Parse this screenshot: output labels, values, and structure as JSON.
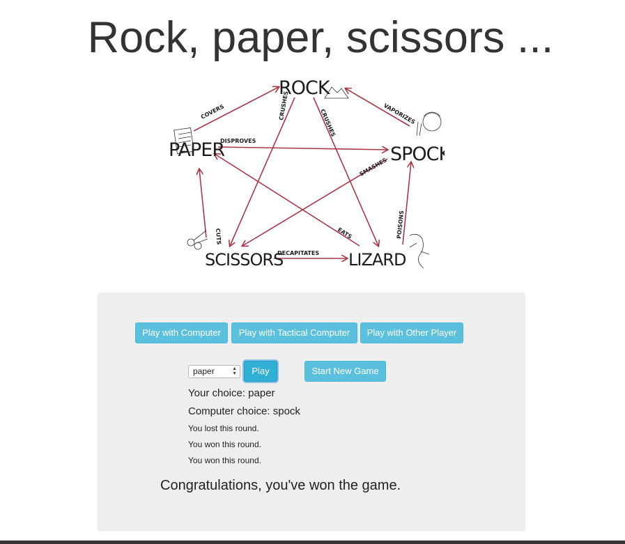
{
  "page": {
    "title": "Rock, paper, scissors ..."
  },
  "diagram": {
    "nodes": {
      "rock": "ROCK",
      "paper": "PAPER",
      "spock": "SPOCK",
      "scissors": "SCISSORS",
      "lizard": "LIZARD"
    },
    "verbs": {
      "covers": "COVERS",
      "crushes_scissors": "CRUSHES",
      "crushes_lizard": "CRUSHES",
      "vaporizes": "VAPORIZES",
      "disproves": "DISPROVES",
      "smashes": "SMASHES",
      "cuts": "CUTS",
      "eats": "EATS",
      "poisons": "POISONS",
      "decapitates": "DECAPITATES"
    },
    "arrow_color": "#a93847"
  },
  "mode_buttons": {
    "computer": "Play with Computer",
    "tactical": "Play with Tactical Computer",
    "other_player": "Play with Other Player"
  },
  "controls": {
    "selected_choice": "paper",
    "play_label": "Play",
    "new_game_label": "Start New Game"
  },
  "status": {
    "your_choice": "Your choice: paper",
    "computer_choice": "Computer choice: spock",
    "rounds": [
      "You lost this round.",
      "You won this round.",
      "You won this round."
    ],
    "final_message": "Congratulations, you've won the game."
  },
  "colors": {
    "button_info": "#5bc0de",
    "panel_background": "#eeeeee"
  }
}
